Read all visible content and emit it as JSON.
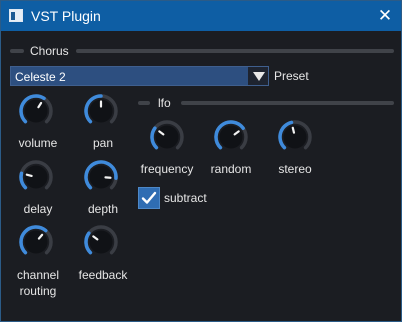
{
  "window": {
    "title": "VST Plugin",
    "close_glyph": "✕"
  },
  "chorus": {
    "group_title": "Chorus",
    "preset": {
      "value": "Celeste 2",
      "label": "Preset"
    },
    "knobs": [
      {
        "label": "volume",
        "value": 0.62
      },
      {
        "label": "pan",
        "value": 0.5
      },
      {
        "label": "delay",
        "value": 0.22
      },
      {
        "label": "depth",
        "value": 0.85
      },
      {
        "label": "channel routing",
        "value": 0.65
      },
      {
        "label": "feedback",
        "value": 0.3
      }
    ],
    "knob_labels_display": {
      "channel_line1": "channel",
      "channel_line2": "routing"
    }
  },
  "lfo": {
    "group_title": "lfo",
    "knobs": [
      {
        "label": "frequency",
        "value": 0.3
      },
      {
        "label": "random",
        "value": 0.7
      },
      {
        "label": "stereo",
        "value": 0.45
      }
    ],
    "subtract": {
      "label": "subtract",
      "checked": true
    }
  },
  "colors": {
    "accent": "#3f8bdc",
    "knob_track": "#3a3d44",
    "knob_body": "#101216",
    "titlebar": "#0e5ea4"
  },
  "icons": {
    "app": "window-icon",
    "close": "close-icon",
    "combo": "chevron-down-icon",
    "check": "checkmark-icon"
  }
}
